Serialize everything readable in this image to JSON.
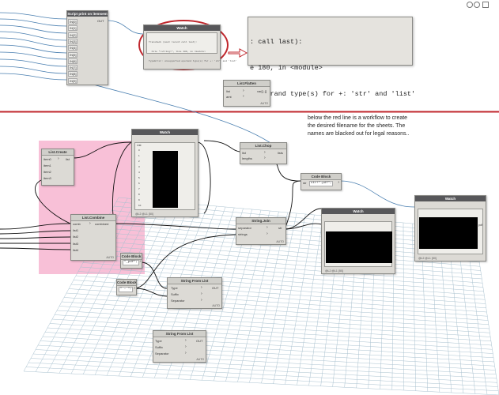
{
  "annotation": {
    "lines": [
      "below the red line is a workflow to create",
      "the desired filename for the sheets. The",
      "names are blacked out for legal reasons.."
    ]
  },
  "colors": {
    "red_line": "#c0272d",
    "wire": "#4a7fb0",
    "wire_dark": "#111111",
    "highlight": "#f7b9d3",
    "node_header": "#57575a"
  },
  "toolbar": {
    "zoom_icon_1": "zoom-in-icon",
    "zoom_icon_2": "zoom-out-icon"
  },
  "python_node": {
    "title": "Script print on itemsem",
    "inputs": [
      "IN[0]",
      "IN[1]",
      "IN[2]",
      "IN[3]",
      "IN[4]",
      "IN[5]",
      "IN[6]",
      "IN[7]",
      "IN[8]",
      "IN[9]"
    ],
    "output": "OUT"
  },
  "watch_error": {
    "title": "Watch",
    "text_lines": [
      "Traceback (most recent call last):",
      "  File \"<string>\", line 180, in <module>",
      "TypeError: unsupported operand type(s) for +: 'str' and 'list'"
    ]
  },
  "zoomed_error": {
    "lines": [
      ": call last):",
      "e 180, in <module>",
      "l operand type(s) for +: 'str' and 'list'"
    ]
  },
  "list_flatten": {
    "title": "List.Flatten",
    "inputs": [
      "list",
      "amt"
    ],
    "default": "var[]..[]",
    "footer": "AUTO"
  },
  "list_create": {
    "title": "List.Create",
    "inputs": [
      "item0",
      "item1",
      "item2",
      "item3"
    ],
    "output": "list"
  },
  "watch_mid": {
    "title": "Watch",
    "list_label": "List",
    "rows": [
      "0",
      "1",
      "2",
      "3",
      "4",
      "5",
      "6",
      "7",
      "8",
      "9",
      "10"
    ],
    "footer": "@L2 @L1 {50}"
  },
  "list_chop": {
    "title": "List.Chop",
    "inputs": [
      "list",
      "lengths"
    ],
    "output": "lists"
  },
  "code_block_pdf": {
    "title": "Code Block",
    "var": "str",
    "code": "str+\".pdf\";"
  },
  "list_combine": {
    "title": "List.Combine",
    "inputs": [
      "comb",
      "list1",
      "list2",
      "list3",
      "list4"
    ],
    "output": "combined",
    "footer": "AUTO"
  },
  "string_join": {
    "title": "String.Join",
    "inputs": [
      "separator",
      "strings"
    ],
    "output": "str",
    "footer": "AUTO"
  },
  "watch_center": {
    "title": "Watch",
    "footer": "@L2 @L1 {50}"
  },
  "watch_right": {
    "title": "Watch",
    "side_label": "pdf",
    "footer": "@L2 @L1 {50}"
  },
  "code_block_small": {
    "title": "Code Block",
    "code": "\"_pdf\";"
  },
  "code_block_dash": {
    "title": "Code Block",
    "code": "\" - \";"
  },
  "string_from_list_1": {
    "title": "String From List",
    "inputs": [
      "Type",
      "Suffix",
      "Separator"
    ],
    "output": "OUT",
    "footer": "AUTO"
  },
  "string_from_list_2": {
    "title": "String From List",
    "inputs": [
      "Type",
      "Suffix",
      "Separator"
    ],
    "output": "OUT",
    "footer": "AUTO"
  }
}
